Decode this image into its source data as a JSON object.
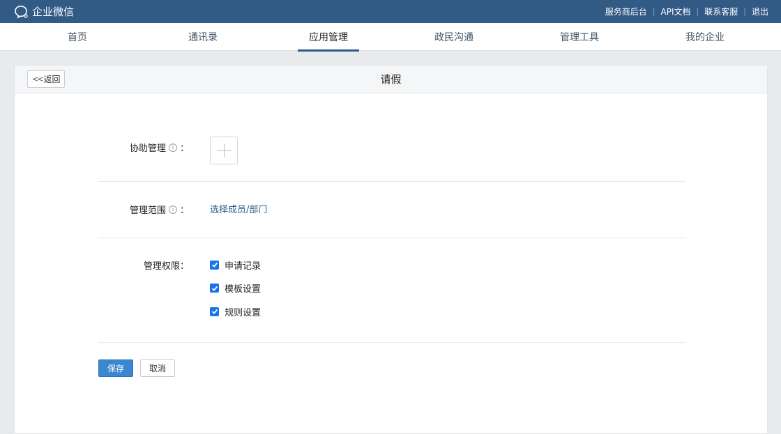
{
  "topbar": {
    "brand_icon": "wechat-work-logo-icon",
    "brand_name": "企业微信",
    "links": [
      "服务商后台",
      "API文档",
      "联系客服",
      "退出"
    ],
    "separator": "|"
  },
  "nav": {
    "tabs": [
      {
        "label": "首页"
      },
      {
        "label": "通讯录"
      },
      {
        "label": "应用管理"
      },
      {
        "label": "政民沟通"
      },
      {
        "label": "管理工具"
      },
      {
        "label": "我的企业"
      }
    ],
    "active": "应用管理"
  },
  "panel": {
    "back_label": "返回",
    "back_icon": "double-chevron-left-icon",
    "title": "请假"
  },
  "form": {
    "assist_admin_label": "协助管理",
    "assist_admin_add_icon": "plus-icon",
    "scope_label": "管理范围",
    "scope_link": "选择成员/部门",
    "info_icon": "info-circle-icon",
    "colon": "：",
    "permissions_label": "管理权限：",
    "permissions": [
      {
        "label": "申请记录",
        "checked": true
      },
      {
        "label": "模板设置",
        "checked": true
      },
      {
        "label": "规则设置",
        "checked": true
      }
    ]
  },
  "actions": {
    "save_label": "保存",
    "cancel_label": "取消"
  },
  "colors": {
    "topbar": "#315a85",
    "accent": "#2b5a8c",
    "checkbox": "#1a73e8",
    "save_button": "#3a87cf"
  }
}
